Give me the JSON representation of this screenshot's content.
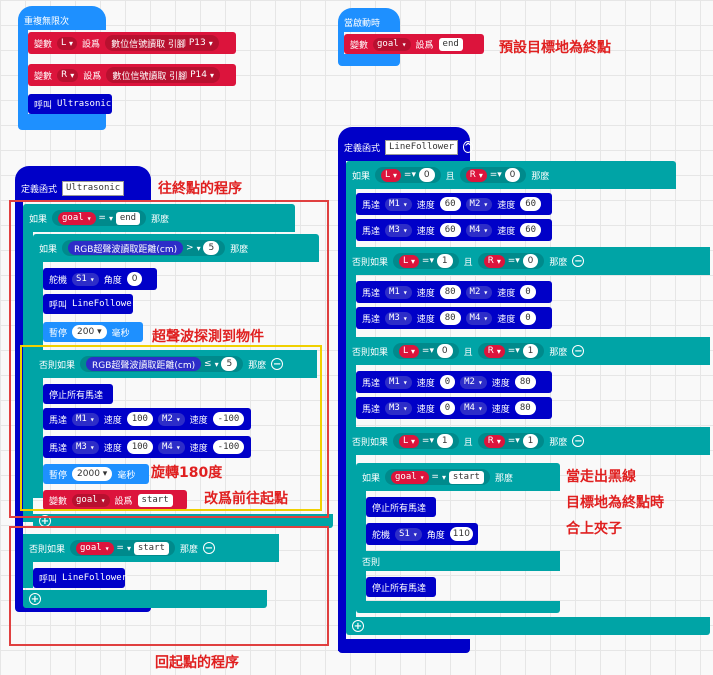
{
  "forever": {
    "title": "重複無限次",
    "rows": [
      {
        "prefix": "變數",
        "var": "L",
        "set": "設爲",
        "fn": "數位信號讀取 引腳",
        "pin": "P13"
      },
      {
        "prefix": "變數",
        "var": "R",
        "set": "設爲",
        "fn": "數位信號讀取 引腳",
        "pin": "P14"
      }
    ],
    "call": {
      "label": "呼叫",
      "name": "Ultrasonic"
    }
  },
  "onstart": {
    "title": "當啟動時",
    "row": {
      "prefix": "變數",
      "var": "goal",
      "set": "設爲",
      "value": "end"
    }
  },
  "ultrasonic": {
    "define": "定義函式",
    "name": "Ultrasonic",
    "if1": {
      "kw": "如果",
      "var": "goal",
      "op": "=",
      "value": "end",
      "then": "那麼"
    },
    "if2": {
      "kw": "如果",
      "sensor": "RGB超聲波讀取距離(cm)",
      "op": ">",
      "value": "5",
      "then": "那麼"
    },
    "servo": {
      "kw": "舵機",
      "id": "S1",
      "angle_label": "角度",
      "angle": "0"
    },
    "callLF": {
      "label": "呼叫",
      "name": "LineFollower"
    },
    "pause1": {
      "kw": "暫停",
      "ms": "200",
      "unit": "毫秒"
    },
    "elseif2": {
      "kw": "否則如果",
      "sensor": "RGB超聲波讀取距離(cm)",
      "op": "≤",
      "value": "5",
      "then": "那麼"
    },
    "stop": "停止所有馬達",
    "motor1": {
      "kw": "馬達",
      "m1": "M1",
      "speed": "速度",
      "v1": "100",
      "m2": "M2",
      "v2": "-100"
    },
    "motor2": {
      "kw": "馬達",
      "m1": "M3",
      "speed": "速度",
      "v1": "100",
      "m2": "M4",
      "v2": "-100"
    },
    "pause2": {
      "kw": "暫停",
      "ms": "2000",
      "unit": "毫秒"
    },
    "setgoal": {
      "prefix": "變數",
      "var": "goal",
      "set": "設爲",
      "value": "start"
    },
    "elseif1": {
      "kw": "否則如果",
      "var": "goal",
      "op": "=",
      "value": "start",
      "then": "那麼"
    },
    "callLF2": {
      "label": "呼叫",
      "name": "LineFollower"
    }
  },
  "linefollower": {
    "define": "定義函式",
    "name": "LineFollower",
    "conds": [
      {
        "kw": "如果",
        "a": "L",
        "av": "0",
        "and": "且",
        "b": "R",
        "bv": "0",
        "then": "那麼"
      },
      {
        "kw": "否則如果",
        "a": "L",
        "av": "1",
        "and": "且",
        "b": "R",
        "bv": "0",
        "then": "那麼"
      },
      {
        "kw": "否則如果",
        "a": "L",
        "av": "0",
        "and": "且",
        "b": "R",
        "bv": "1",
        "then": "那麼"
      },
      {
        "kw": "否則如果",
        "a": "L",
        "av": "1",
        "and": "且",
        "b": "R",
        "bv": "1",
        "then": "那麼"
      }
    ],
    "motors": [
      [
        {
          "kw": "馬達",
          "m1": "M1",
          "s": "速度",
          "v1": "60",
          "m2": "M2",
          "v2": "60"
        },
        {
          "kw": "馬達",
          "m1": "M3",
          "s": "速度",
          "v1": "60",
          "m2": "M4",
          "v2": "60"
        }
      ],
      [
        {
          "kw": "馬達",
          "m1": "M1",
          "s": "速度",
          "v1": "80",
          "m2": "M2",
          "v2": "0"
        },
        {
          "kw": "馬達",
          "m1": "M3",
          "s": "速度",
          "v1": "80",
          "m2": "M4",
          "v2": "0"
        }
      ],
      [
        {
          "kw": "馬達",
          "m1": "M1",
          "s": "速度",
          "v1": "0",
          "m2": "M2",
          "v2": "80"
        },
        {
          "kw": "馬達",
          "m1": "M3",
          "s": "速度",
          "v1": "0",
          "m2": "M4",
          "v2": "80"
        }
      ]
    ],
    "inner_if": {
      "kw": "如果",
      "var": "goal",
      "op": "=",
      "value": "start",
      "then": "那麼"
    },
    "stop": "停止所有馬達",
    "servo": {
      "kw": "舵機",
      "id": "S1",
      "angle_label": "角度",
      "angle": "110"
    },
    "else": "否則",
    "stop2": "停止所有馬達"
  },
  "annotations": {
    "set_goal": "預設目標地為終點",
    "to_end": "往終點的程序",
    "detected": "超聲波探測到物件",
    "rotate": "旋轉180度",
    "change": "改爲前往起點",
    "back": "回起點的程序",
    "line1": "當走出黑線",
    "line2": "目標地為終點時",
    "line3": "合上夾子"
  },
  "colors": {
    "loops": "#1e90ff",
    "logic": "#00a4a6",
    "variables": "#dc143c",
    "functions": "#0000c8",
    "note": "#e02020",
    "red_frame": "#e04040",
    "yellow_frame": "#f0d000"
  }
}
